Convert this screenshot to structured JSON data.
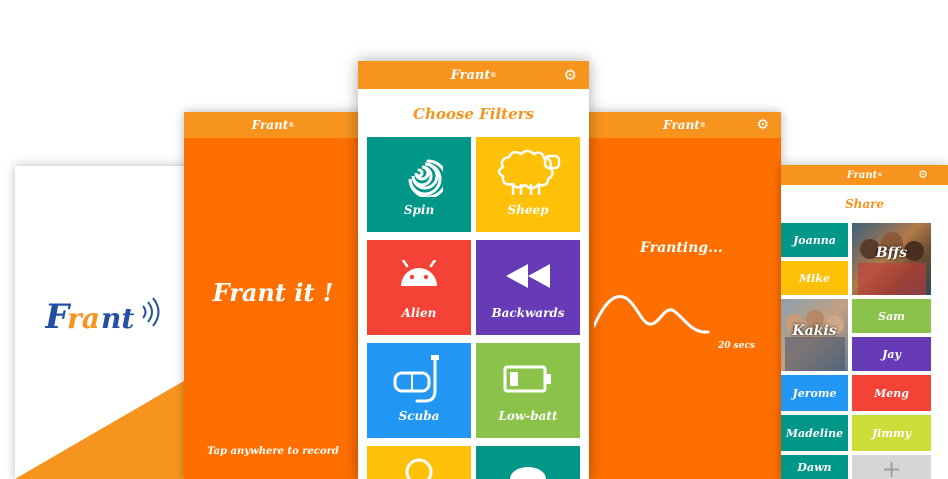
{
  "colors": {
    "brand_orange": "#f7941d",
    "record_orange": "#ff6f00",
    "logo_blue": "#2350a3"
  },
  "splash": {
    "logo_text": "Frant"
  },
  "record_screen": {
    "app_name": "Frant",
    "title": "Frant it !",
    "hint": "Tap anywhere to record"
  },
  "filters_screen": {
    "app_name": "Frant",
    "heading": "Choose Filters",
    "filters": [
      {
        "label": "Spin",
        "icon": "spiral-icon",
        "color": "#009688"
      },
      {
        "label": "Sheep",
        "icon": "sheep-icon",
        "color": "#ffc107"
      },
      {
        "label": "Alien",
        "icon": "android-icon",
        "color": "#f44336"
      },
      {
        "label": "Backwards",
        "icon": "rewind-icon",
        "color": "#673ab7"
      },
      {
        "label": "Scuba",
        "icon": "scuba-mask-icon",
        "color": "#2196f3"
      },
      {
        "label": "Low-batt",
        "icon": "battery-low-icon",
        "color": "#8bc34a"
      }
    ],
    "partial_tiles": [
      {
        "color": "#ffc107"
      },
      {
        "color": "#009688"
      }
    ]
  },
  "franting_screen": {
    "app_name": "Frant",
    "status": "Franting...",
    "timer": "20 secs"
  },
  "share_screen": {
    "app_name": "Frant",
    "title": "Share",
    "contacts": [
      {
        "label": "Joanna",
        "color": "#009688"
      },
      {
        "label": "Mike",
        "color": "#ffc107"
      },
      {
        "label": "Sam",
        "color": "#8bc34a"
      },
      {
        "label": "Jay",
        "color": "#673ab7"
      },
      {
        "label": "Jerome",
        "color": "#2196f3"
      },
      {
        "label": "Meng",
        "color": "#f44336"
      },
      {
        "label": "Madeline",
        "color": "#009688"
      },
      {
        "label": "Jimmy",
        "color": "#cddc39"
      },
      {
        "label": "Dawn",
        "color": "#009688"
      }
    ],
    "groups": [
      {
        "label": "Bffs"
      },
      {
        "label": "Kakis"
      }
    ],
    "add_symbol": "+"
  }
}
